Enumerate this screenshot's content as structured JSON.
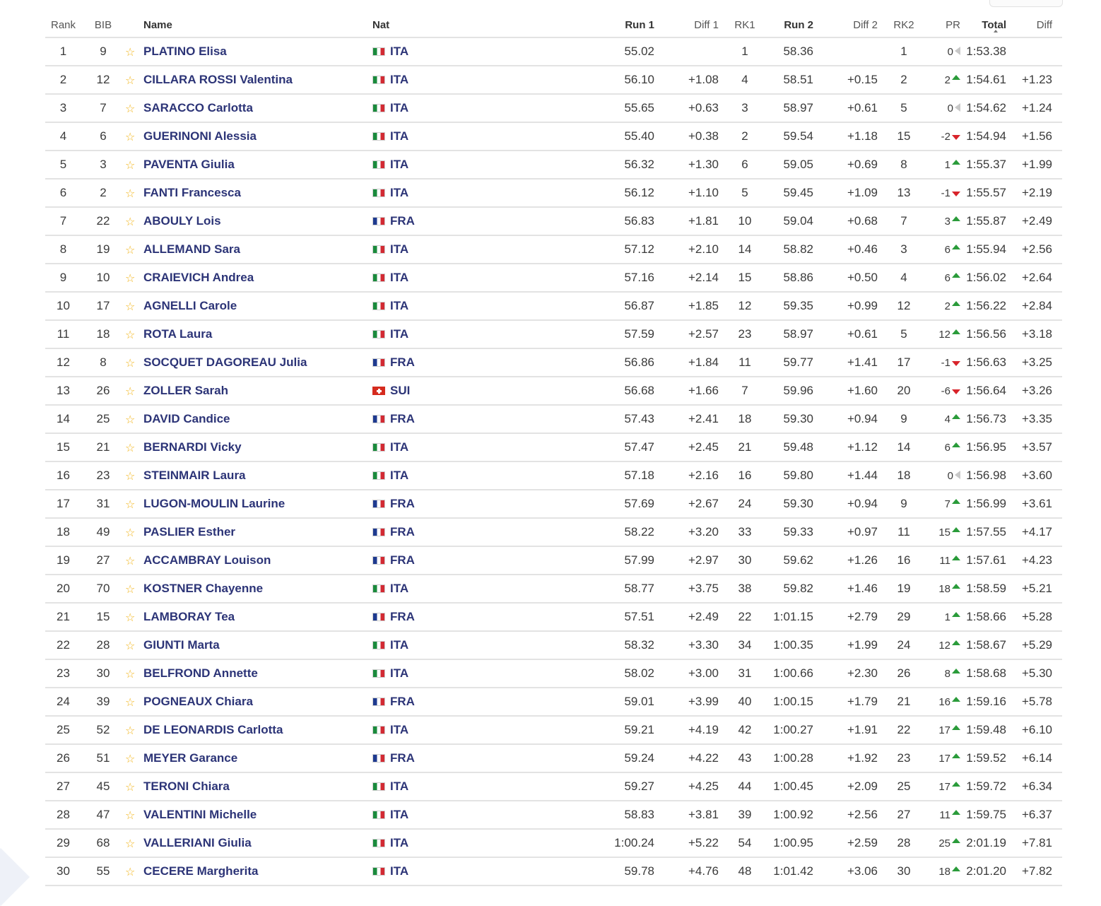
{
  "headers": {
    "rank": "Rank",
    "bib": "BIB",
    "name": "Name",
    "nat": "Nat",
    "run1": "Run 1",
    "diff1": "Diff 1",
    "rk1": "RK1",
    "run2": "Run 2",
    "diff2": "Diff 2",
    "rk2": "RK2",
    "pr": "PR",
    "total": "Total",
    "diff": "Diff"
  },
  "colors": {
    "name": "#2c3477",
    "star": "#f2b51b",
    "up": "#2a9b3a",
    "down": "#d8232a",
    "same": "#c8c8c8"
  },
  "rows": [
    {
      "rank": "1",
      "bib": "9",
      "name": "PLATINO Elisa",
      "nat": "ITA",
      "run1": "55.02",
      "diff1": "",
      "rk1": "1",
      "run2": "58.36",
      "diff2": "",
      "rk2": "1",
      "pr": "0",
      "trend": "same",
      "total": "1:53.38",
      "diff": ""
    },
    {
      "rank": "2",
      "bib": "12",
      "name": "CILLARA ROSSI Valentina",
      "nat": "ITA",
      "run1": "56.10",
      "diff1": "+1.08",
      "rk1": "4",
      "run2": "58.51",
      "diff2": "+0.15",
      "rk2": "2",
      "pr": "2",
      "trend": "up",
      "total": "1:54.61",
      "diff": "+1.23"
    },
    {
      "rank": "3",
      "bib": "7",
      "name": "SARACCO Carlotta",
      "nat": "ITA",
      "run1": "55.65",
      "diff1": "+0.63",
      "rk1": "3",
      "run2": "58.97",
      "diff2": "+0.61",
      "rk2": "5",
      "pr": "0",
      "trend": "same",
      "total": "1:54.62",
      "diff": "+1.24"
    },
    {
      "rank": "4",
      "bib": "6",
      "name": "GUERINONI Alessia",
      "nat": "ITA",
      "run1": "55.40",
      "diff1": "+0.38",
      "rk1": "2",
      "run2": "59.54",
      "diff2": "+1.18",
      "rk2": "15",
      "pr": "-2",
      "trend": "down",
      "total": "1:54.94",
      "diff": "+1.56"
    },
    {
      "rank": "5",
      "bib": "3",
      "name": "PAVENTA Giulia",
      "nat": "ITA",
      "run1": "56.32",
      "diff1": "+1.30",
      "rk1": "6",
      "run2": "59.05",
      "diff2": "+0.69",
      "rk2": "8",
      "pr": "1",
      "trend": "up",
      "total": "1:55.37",
      "diff": "+1.99"
    },
    {
      "rank": "6",
      "bib": "2",
      "name": "FANTI Francesca",
      "nat": "ITA",
      "run1": "56.12",
      "diff1": "+1.10",
      "rk1": "5",
      "run2": "59.45",
      "diff2": "+1.09",
      "rk2": "13",
      "pr": "-1",
      "trend": "down",
      "total": "1:55.57",
      "diff": "+2.19"
    },
    {
      "rank": "7",
      "bib": "22",
      "name": "ABOULY Lois",
      "nat": "FRA",
      "run1": "56.83",
      "diff1": "+1.81",
      "rk1": "10",
      "run2": "59.04",
      "diff2": "+0.68",
      "rk2": "7",
      "pr": "3",
      "trend": "up",
      "total": "1:55.87",
      "diff": "+2.49"
    },
    {
      "rank": "8",
      "bib": "19",
      "name": "ALLEMAND Sara",
      "nat": "ITA",
      "run1": "57.12",
      "diff1": "+2.10",
      "rk1": "14",
      "run2": "58.82",
      "diff2": "+0.46",
      "rk2": "3",
      "pr": "6",
      "trend": "up",
      "total": "1:55.94",
      "diff": "+2.56"
    },
    {
      "rank": "9",
      "bib": "10",
      "name": "CRAIEVICH Andrea",
      "nat": "ITA",
      "run1": "57.16",
      "diff1": "+2.14",
      "rk1": "15",
      "run2": "58.86",
      "diff2": "+0.50",
      "rk2": "4",
      "pr": "6",
      "trend": "up",
      "total": "1:56.02",
      "diff": "+2.64"
    },
    {
      "rank": "10",
      "bib": "17",
      "name": "AGNELLI Carole",
      "nat": "ITA",
      "run1": "56.87",
      "diff1": "+1.85",
      "rk1": "12",
      "run2": "59.35",
      "diff2": "+0.99",
      "rk2": "12",
      "pr": "2",
      "trend": "up",
      "total": "1:56.22",
      "diff": "+2.84"
    },
    {
      "rank": "11",
      "bib": "18",
      "name": "ROTA Laura",
      "nat": "ITA",
      "run1": "57.59",
      "diff1": "+2.57",
      "rk1": "23",
      "run2": "58.97",
      "diff2": "+0.61",
      "rk2": "5",
      "pr": "12",
      "trend": "up",
      "total": "1:56.56",
      "diff": "+3.18"
    },
    {
      "rank": "12",
      "bib": "8",
      "name": "SOCQUET DAGOREAU Julia",
      "nat": "FRA",
      "run1": "56.86",
      "diff1": "+1.84",
      "rk1": "11",
      "run2": "59.77",
      "diff2": "+1.41",
      "rk2": "17",
      "pr": "-1",
      "trend": "down",
      "total": "1:56.63",
      "diff": "+3.25"
    },
    {
      "rank": "13",
      "bib": "26",
      "name": "ZOLLER Sarah",
      "nat": "SUI",
      "run1": "56.68",
      "diff1": "+1.66",
      "rk1": "7",
      "run2": "59.96",
      "diff2": "+1.60",
      "rk2": "20",
      "pr": "-6",
      "trend": "down",
      "total": "1:56.64",
      "diff": "+3.26"
    },
    {
      "rank": "14",
      "bib": "25",
      "name": "DAVID Candice",
      "nat": "FRA",
      "run1": "57.43",
      "diff1": "+2.41",
      "rk1": "18",
      "run2": "59.30",
      "diff2": "+0.94",
      "rk2": "9",
      "pr": "4",
      "trend": "up",
      "total": "1:56.73",
      "diff": "+3.35"
    },
    {
      "rank": "15",
      "bib": "21",
      "name": "BERNARDI Vicky",
      "nat": "ITA",
      "run1": "57.47",
      "diff1": "+2.45",
      "rk1": "21",
      "run2": "59.48",
      "diff2": "+1.12",
      "rk2": "14",
      "pr": "6",
      "trend": "up",
      "total": "1:56.95",
      "diff": "+3.57"
    },
    {
      "rank": "16",
      "bib": "23",
      "name": "STEINMAIR Laura",
      "nat": "ITA",
      "run1": "57.18",
      "diff1": "+2.16",
      "rk1": "16",
      "run2": "59.80",
      "diff2": "+1.44",
      "rk2": "18",
      "pr": "0",
      "trend": "same",
      "total": "1:56.98",
      "diff": "+3.60"
    },
    {
      "rank": "17",
      "bib": "31",
      "name": "LUGON-MOULIN Laurine",
      "nat": "FRA",
      "run1": "57.69",
      "diff1": "+2.67",
      "rk1": "24",
      "run2": "59.30",
      "diff2": "+0.94",
      "rk2": "9",
      "pr": "7",
      "trend": "up",
      "total": "1:56.99",
      "diff": "+3.61"
    },
    {
      "rank": "18",
      "bib": "49",
      "name": "PASLIER Esther",
      "nat": "FRA",
      "run1": "58.22",
      "diff1": "+3.20",
      "rk1": "33",
      "run2": "59.33",
      "diff2": "+0.97",
      "rk2": "11",
      "pr": "15",
      "trend": "up",
      "total": "1:57.55",
      "diff": "+4.17"
    },
    {
      "rank": "19",
      "bib": "27",
      "name": "ACCAMBRAY Louison",
      "nat": "FRA",
      "run1": "57.99",
      "diff1": "+2.97",
      "rk1": "30",
      "run2": "59.62",
      "diff2": "+1.26",
      "rk2": "16",
      "pr": "11",
      "trend": "up",
      "total": "1:57.61",
      "diff": "+4.23"
    },
    {
      "rank": "20",
      "bib": "70",
      "name": "KOSTNER Chayenne",
      "nat": "ITA",
      "run1": "58.77",
      "diff1": "+3.75",
      "rk1": "38",
      "run2": "59.82",
      "diff2": "+1.46",
      "rk2": "19",
      "pr": "18",
      "trend": "up",
      "total": "1:58.59",
      "diff": "+5.21"
    },
    {
      "rank": "21",
      "bib": "15",
      "name": "LAMBORAY Tea",
      "nat": "FRA",
      "run1": "57.51",
      "diff1": "+2.49",
      "rk1": "22",
      "run2": "1:01.15",
      "diff2": "+2.79",
      "rk2": "29",
      "pr": "1",
      "trend": "up",
      "total": "1:58.66",
      "diff": "+5.28"
    },
    {
      "rank": "22",
      "bib": "28",
      "name": "GIUNTI Marta",
      "nat": "ITA",
      "run1": "58.32",
      "diff1": "+3.30",
      "rk1": "34",
      "run2": "1:00.35",
      "diff2": "+1.99",
      "rk2": "24",
      "pr": "12",
      "trend": "up",
      "total": "1:58.67",
      "diff": "+5.29"
    },
    {
      "rank": "23",
      "bib": "30",
      "name": "BELFROND Annette",
      "nat": "ITA",
      "run1": "58.02",
      "diff1": "+3.00",
      "rk1": "31",
      "run2": "1:00.66",
      "diff2": "+2.30",
      "rk2": "26",
      "pr": "8",
      "trend": "up",
      "total": "1:58.68",
      "diff": "+5.30"
    },
    {
      "rank": "24",
      "bib": "39",
      "name": "POGNEAUX Chiara",
      "nat": "FRA",
      "run1": "59.01",
      "diff1": "+3.99",
      "rk1": "40",
      "run2": "1:00.15",
      "diff2": "+1.79",
      "rk2": "21",
      "pr": "16",
      "trend": "up",
      "total": "1:59.16",
      "diff": "+5.78"
    },
    {
      "rank": "25",
      "bib": "52",
      "name": "DE LEONARDIS Carlotta",
      "nat": "ITA",
      "run1": "59.21",
      "diff1": "+4.19",
      "rk1": "42",
      "run2": "1:00.27",
      "diff2": "+1.91",
      "rk2": "22",
      "pr": "17",
      "trend": "up",
      "total": "1:59.48",
      "diff": "+6.10"
    },
    {
      "rank": "26",
      "bib": "51",
      "name": "MEYER Garance",
      "nat": "FRA",
      "run1": "59.24",
      "diff1": "+4.22",
      "rk1": "43",
      "run2": "1:00.28",
      "diff2": "+1.92",
      "rk2": "23",
      "pr": "17",
      "trend": "up",
      "total": "1:59.52",
      "diff": "+6.14"
    },
    {
      "rank": "27",
      "bib": "45",
      "name": "TERONI Chiara",
      "nat": "ITA",
      "run1": "59.27",
      "diff1": "+4.25",
      "rk1": "44",
      "run2": "1:00.45",
      "diff2": "+2.09",
      "rk2": "25",
      "pr": "17",
      "trend": "up",
      "total": "1:59.72",
      "diff": "+6.34"
    },
    {
      "rank": "28",
      "bib": "47",
      "name": "VALENTINI Michelle",
      "nat": "ITA",
      "run1": "58.83",
      "diff1": "+3.81",
      "rk1": "39",
      "run2": "1:00.92",
      "diff2": "+2.56",
      "rk2": "27",
      "pr": "11",
      "trend": "up",
      "total": "1:59.75",
      "diff": "+6.37"
    },
    {
      "rank": "29",
      "bib": "68",
      "name": "VALLERIANI Giulia",
      "nat": "ITA",
      "run1": "1:00.24",
      "diff1": "+5.22",
      "rk1": "54",
      "run2": "1:00.95",
      "diff2": "+2.59",
      "rk2": "28",
      "pr": "25",
      "trend": "up",
      "total": "2:01.19",
      "diff": "+7.81"
    },
    {
      "rank": "30",
      "bib": "55",
      "name": "CECERE Margherita",
      "nat": "ITA",
      "run1": "59.78",
      "diff1": "+4.76",
      "rk1": "48",
      "run2": "1:01.42",
      "diff2": "+3.06",
      "rk2": "30",
      "pr": "18",
      "trend": "up",
      "total": "2:01.20",
      "diff": "+7.82"
    }
  ]
}
